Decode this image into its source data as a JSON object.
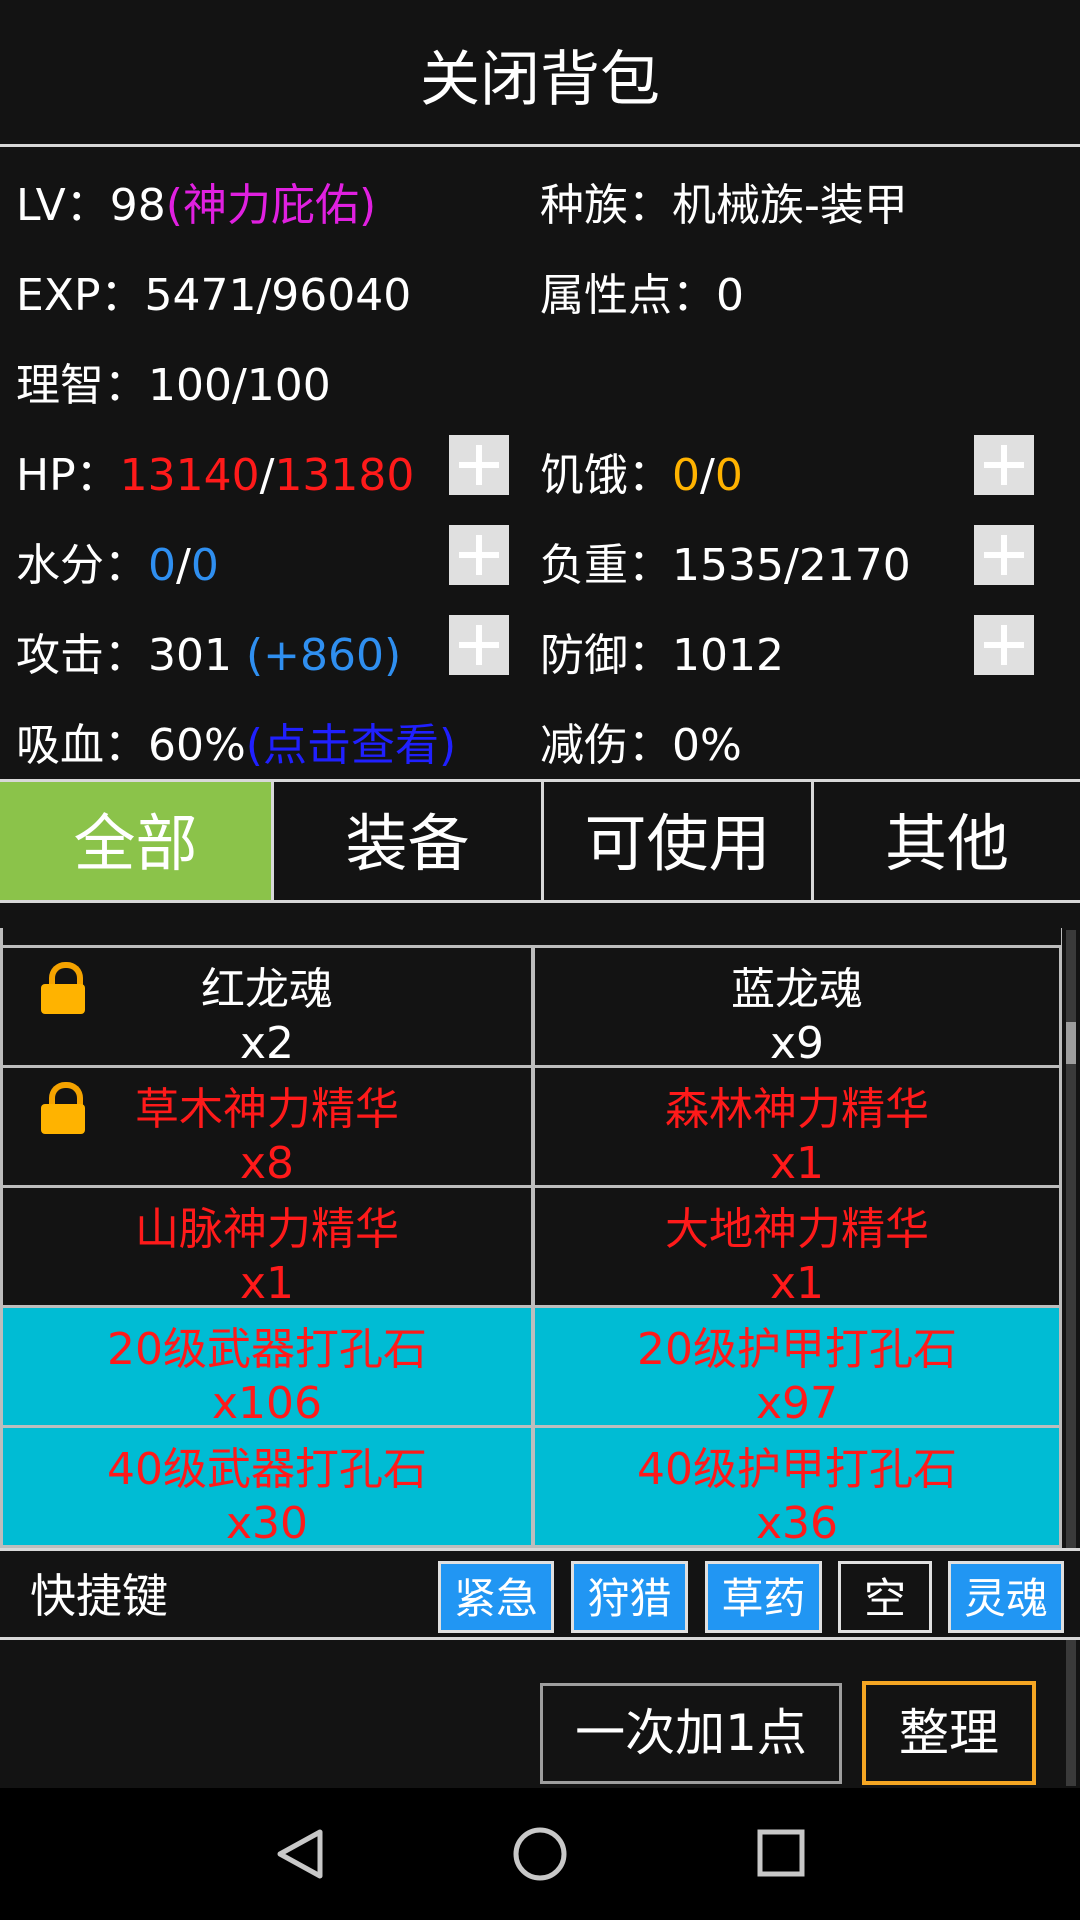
{
  "header": {
    "title": "关闭背包"
  },
  "stats": {
    "lv_label": "LV：",
    "lv_value": "98",
    "lv_blessing": "(神力庇佑)",
    "race_label": "种族：",
    "race_value": "机械族-装甲",
    "exp_label": "EXP：",
    "exp_value": "5471/96040",
    "attr_label": "属性点：",
    "attr_value": "0",
    "sanity_label": "理智：",
    "sanity_value": "100/100",
    "hp_label": "HP：",
    "hp_cur": "13140",
    "hp_sep": "/",
    "hp_max": "13180",
    "hunger_label": "饥饿：",
    "hunger_cur": "0",
    "hunger_sep": "/",
    "hunger_max": "0",
    "water_label": "水分：",
    "water_cur": "0",
    "water_sep": "/",
    "water_max": "0",
    "load_label": "负重：",
    "load_value": "1535/2170",
    "atk_label": "攻击：",
    "atk_value": "301 ",
    "atk_bonus": "(+860)",
    "def_label": "防御：",
    "def_value": "1012",
    "lifesteal_label": "吸血：",
    "lifesteal_value": "60%",
    "lifesteal_link": "(点击查看)",
    "dmgred_label": "减伤：",
    "dmgred_value": "0%"
  },
  "tabs": [
    {
      "label": "全部",
      "active": true
    },
    {
      "label": "装备",
      "active": false
    },
    {
      "label": "可使用",
      "active": false
    },
    {
      "label": "其他",
      "active": false
    }
  ],
  "items": [
    {
      "name": "红龙魂",
      "count": "x2",
      "locked": true,
      "style": "dark",
      "color": "white"
    },
    {
      "name": "蓝龙魂",
      "count": "x9",
      "locked": false,
      "style": "dark",
      "color": "white"
    },
    {
      "name": "草木神力精华",
      "count": "x8",
      "locked": true,
      "style": "dark",
      "color": "red"
    },
    {
      "name": "森林神力精华",
      "count": "x1",
      "locked": false,
      "style": "dark",
      "color": "red"
    },
    {
      "name": "山脉神力精华",
      "count": "x1",
      "locked": false,
      "style": "dark",
      "color": "red"
    },
    {
      "name": "大地神力精华",
      "count": "x1",
      "locked": false,
      "style": "dark",
      "color": "red"
    },
    {
      "name": "20级武器打孔石",
      "count": "x106",
      "locked": false,
      "style": "cyan",
      "color": "red"
    },
    {
      "name": "20级护甲打孔石",
      "count": "x97",
      "locked": false,
      "style": "cyan",
      "color": "red"
    },
    {
      "name": "40级武器打孔石",
      "count": "x30",
      "locked": false,
      "style": "cyan",
      "color": "red"
    },
    {
      "name": "40级护甲打孔石",
      "count": "x36",
      "locked": false,
      "style": "cyan",
      "color": "red"
    }
  ],
  "shortcut": {
    "label": "快捷键",
    "keys": [
      {
        "label": "紧急",
        "empty": false
      },
      {
        "label": "狩猎",
        "empty": false
      },
      {
        "label": "草药",
        "empty": false
      },
      {
        "label": "空",
        "empty": true
      },
      {
        "label": "灵魂",
        "empty": false
      }
    ]
  },
  "buttons": {
    "add_one": "一次加1点",
    "sort": "整理"
  },
  "colors": {
    "accent_green": "#8bc34a",
    "item_cyan": "#00bcd4",
    "shortcut_blue": "#2196f3",
    "hp_red": "#ff1a1a",
    "hunger_gold": "#ffb300",
    "water_blue": "#2f8ff0",
    "blessing_magenta": "#e020e0",
    "link_blue": "#2020ff",
    "sort_border": "#f5a623"
  },
  "navbar": {
    "icons": [
      "back-triangle-icon",
      "home-circle-icon",
      "recents-square-icon"
    ]
  }
}
